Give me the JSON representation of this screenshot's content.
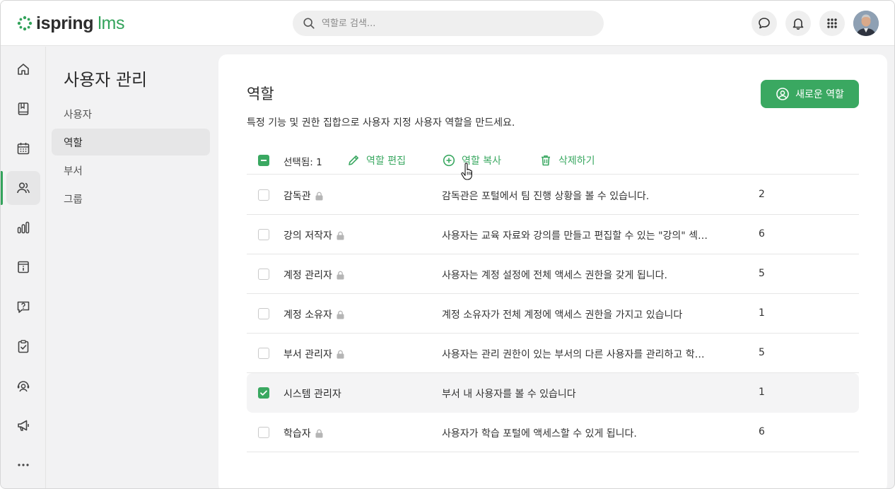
{
  "app": {
    "logo_main": "ispring",
    "logo_sub": "lms"
  },
  "search": {
    "placeholder": "역할로 검색..."
  },
  "header": {
    "icons": [
      "chat-icon",
      "bell-icon",
      "apps-grid-icon"
    ],
    "avatar": "user-avatar"
  },
  "rail": {
    "items": [
      "home-icon",
      "book-icon",
      "calendar-icon",
      "users-icon",
      "chart-icon",
      "info-icon",
      "question-icon",
      "clipboard-check-icon",
      "support-agent-icon",
      "megaphone-icon",
      "more-icon"
    ],
    "active": "users-icon"
  },
  "subnav": {
    "title": "사용자 관리",
    "items": [
      {
        "label": "사용자"
      },
      {
        "label": "역할"
      },
      {
        "label": "부서"
      },
      {
        "label": "그룹"
      }
    ],
    "active_index": 1
  },
  "main": {
    "title": "역할",
    "description": "특정 기능 및 권한 집합으로 사용자 지정 사용자 역할을 만드세요.",
    "new_role_label": "새로운 역할",
    "toolbar": {
      "selected_label": "선택됨: 1",
      "edit_label": "역할 편집",
      "copy_label": "역할 복사",
      "delete_label": "삭제하기"
    },
    "rows": [
      {
        "name": "감독관",
        "locked": true,
        "description": "감독관은 포털에서 팀 진행 상황을 볼 수 있습니다.",
        "count": "2",
        "checked": false
      },
      {
        "name": "강의 저작자",
        "locked": true,
        "description": "사용자는 교육 자료와 강의를 만들고 편집할 수 있는 \"강의\" 섹…",
        "count": "6",
        "checked": false
      },
      {
        "name": "계정 관리자",
        "locked": true,
        "description": "사용자는 계정 설정에 전체 액세스 권한을 갖게 됩니다.",
        "count": "5",
        "checked": false
      },
      {
        "name": "계정 소유자",
        "locked": true,
        "description": "계정 소유자가 전체 계정에 액세스 권한을 가지고 있습니다",
        "count": "1",
        "checked": false
      },
      {
        "name": "부서 관리자",
        "locked": true,
        "description": "사용자는 관리 권한이 있는 부서의 다른 사용자를 관리하고 학…",
        "count": "5",
        "checked": false
      },
      {
        "name": "시스템 관리자",
        "locked": false,
        "description": "부서 내 사용자를 볼 수 있습니다",
        "count": "1",
        "checked": true
      },
      {
        "name": "학습자",
        "locked": true,
        "description": "사용자가 학습 포털에 액세스할 수 있게 됩니다.",
        "count": "6",
        "checked": false
      }
    ]
  },
  "colors": {
    "accent": "#3aa861",
    "background": "#f2f2f3"
  }
}
